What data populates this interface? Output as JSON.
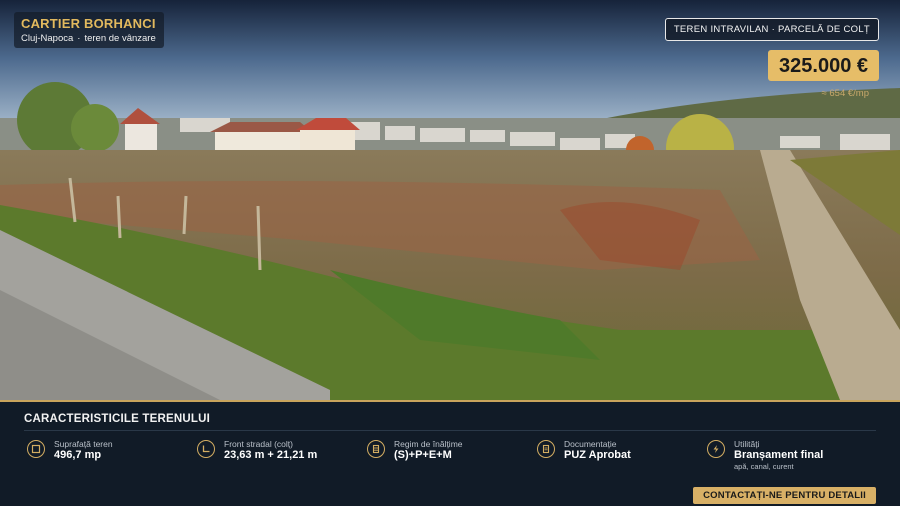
{
  "location": {
    "title": "CARTIER BORHANCI",
    "city": "Cluj-Napoca",
    "separator": "·",
    "listing_type": "teren de vânzare"
  },
  "badge": {
    "text": "TEREN INTRAVILAN · PARCELĂ DE COLȚ"
  },
  "price": {
    "value": "325.000 €",
    "per_sqm": "≈ 654 €/mp"
  },
  "panel": {
    "title": "CARACTERISTICILE TERENULUI",
    "features": [
      {
        "icon": "area-icon",
        "label": "Suprafață teren",
        "value": "496,7 mp"
      },
      {
        "icon": "corner-frontage-icon",
        "label": "Front stradal (colț)",
        "value": "23,63 m + 21,21 m"
      },
      {
        "icon": "building-height-icon",
        "label": "Regim de înălțime",
        "value": "(S)+P+E+M"
      },
      {
        "icon": "document-icon",
        "label": "Documentație",
        "value": "PUZ Aprobat"
      },
      {
        "icon": "lightning-icon",
        "label": "Utilități",
        "value": "Branșament final",
        "note": "apă, canal, curent"
      }
    ],
    "cta": "CONTACTAȚI-NE PENTRU DETALII"
  },
  "colors": {
    "accent": "#e6bd68",
    "panel_bg": "#111b27"
  }
}
